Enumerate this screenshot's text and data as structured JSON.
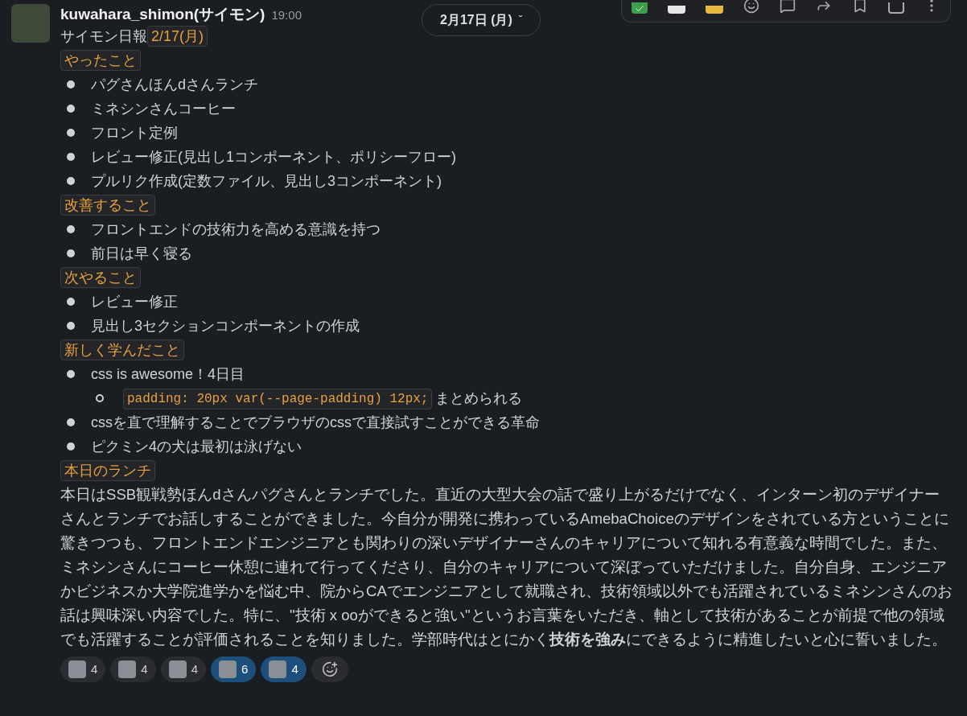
{
  "message": {
    "author": "kuwahara_shimon(サイモン)",
    "time": "19:00",
    "title": "サイモン日報",
    "title_tag": "2/17(月)"
  },
  "date_divider": {
    "label": "2月17日 (月)",
    "caret": "ˇ"
  },
  "sections": [
    {
      "heading": "やったこと",
      "items": [
        {
          "text": "パグさんほんdさんランチ"
        },
        {
          "text": "ミネシンさんコーヒー"
        },
        {
          "text": "フロント定例"
        },
        {
          "text": "レビュー修正(見出し1コンポーネント、ポリシーフロー)"
        },
        {
          "text": "プルリク作成(定数ファイル、見出し3コンポーネント)"
        }
      ]
    },
    {
      "heading": "改善すること",
      "items": [
        {
          "text": "フロントエンドの技術力を高める意識を持つ"
        },
        {
          "text": "前日は早く寝る"
        }
      ]
    },
    {
      "heading": "次やること",
      "items": [
        {
          "text": "レビュー修正"
        },
        {
          "text": "見出し3セクションコンポーネントの作成"
        }
      ]
    },
    {
      "heading": "新しく学んだこと",
      "items": [
        {
          "text": "css is awesome！4日目",
          "children": [
            {
              "code": "padding: 20px var(--page-padding) 12px;",
              "text": "まとめられる"
            }
          ]
        },
        {
          "text": "cssを直で理解することでブラウザのcssで直接試すことができる革命"
        },
        {
          "text": "ピクミン4の犬は最初は泳げない"
        }
      ]
    },
    {
      "heading": "本日のランチ",
      "paragraph": "本日はSSB観戦勢ほんdさんパグさんとランチでした。直近の大型大会の話で盛り上がるだけでなく、インターン初のデザイナーさんとランチでお話しすることができました。今自分が開発に携わっているAmebaChoiceのデザインをされている方ということに驚きつつも、フロントエンドエンジニアとも関わりの深いデザイナーさんのキャリアについて知れる有意義な時間でした。また、ミネシンさんにコーヒー休憩に連れて行ってくださり、自分のキャリアについて深ぼっていただけました。自分自身、エンジニアかビジネスか大学院進学かを悩む中、院からCAでエンジニアとして就職され、技術領域以外でも活躍されているミネシンさんのお話は興味深い内容でした。特に、\"技術 x ooができると強い\"というお言葉をいただき、軸として技術があることが前提で他の領域でも活躍することが評価されることを知りました。学部時代はとにかく**技術を強み**にできるように精進したいと心に誓いました。"
    }
  ],
  "reactions": [
    {
      "count": "4",
      "selected": false
    },
    {
      "count": "4",
      "selected": false
    },
    {
      "count": "4",
      "selected": false
    },
    {
      "count": "6",
      "selected": true
    },
    {
      "count": "4",
      "selected": true
    }
  ]
}
